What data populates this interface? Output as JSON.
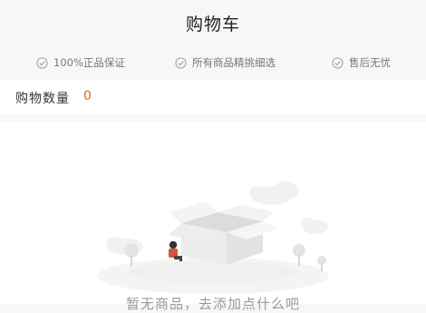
{
  "header": {
    "title": "购物车"
  },
  "guarantees": [
    {
      "label": "100%正品保证",
      "icon": "check-circle-icon"
    },
    {
      "label": "所有商品精挑细选",
      "icon": "check-circle-icon"
    },
    {
      "label": "售后无忧",
      "icon": "check-circle-icon"
    }
  ],
  "cart": {
    "count_label": "购物数量",
    "count_value": "0"
  },
  "empty_state": {
    "message": "暂无商品，去添加点什么吧"
  },
  "colors": {
    "accent": "#e0622d",
    "page_bg": "#f7f7f7"
  }
}
